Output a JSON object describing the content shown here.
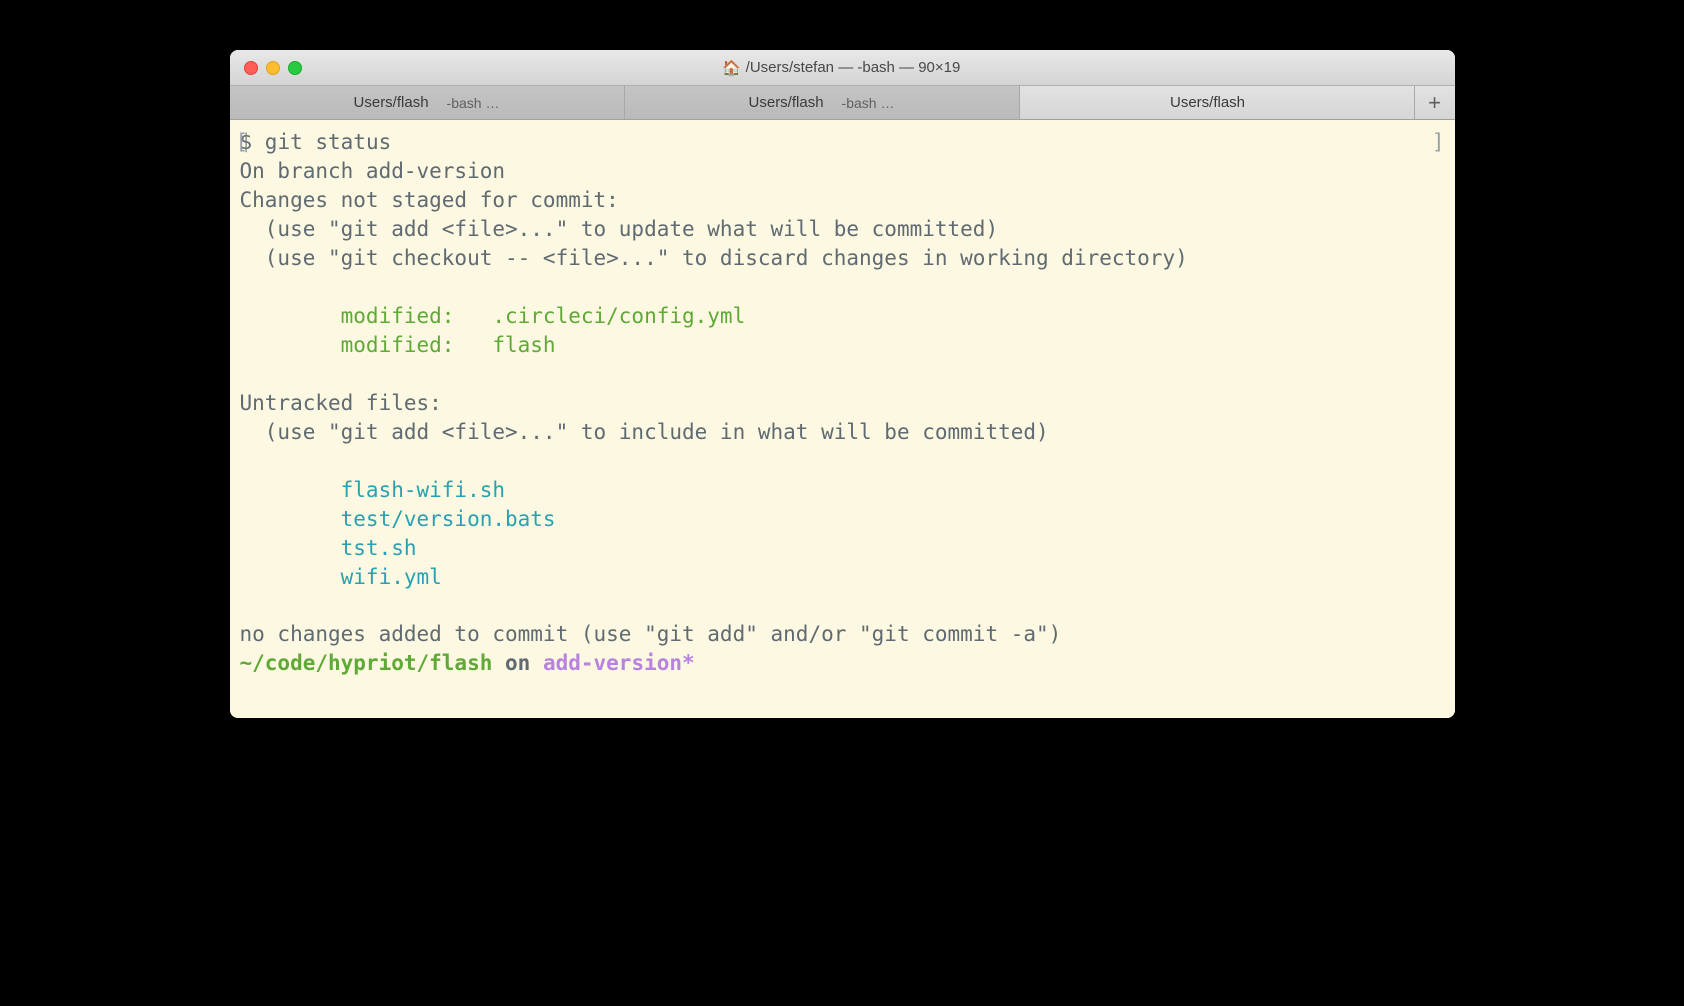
{
  "window": {
    "title": "/Users/stefan — -bash — 90×19",
    "home_icon": "🏠"
  },
  "tabs": [
    {
      "title": "Users/flash",
      "sub": "-bash …",
      "active": false
    },
    {
      "title": "Users/flash",
      "sub": "-bash …",
      "active": false
    },
    {
      "title": "Users/flash",
      "sub": "",
      "active": true
    }
  ],
  "terminal": {
    "bracket_left": "[",
    "bracket_right": "]",
    "prompt": "$ ",
    "command": "git status",
    "lines": {
      "branch": "On branch add-version",
      "not_staged": "Changes not staged for commit:",
      "hint_add": "  (use \"git add <file>...\" to update what will be committed)",
      "hint_checkout": "  (use \"git checkout -- <file>...\" to discard changes in working directory)",
      "modified_1": "        modified:   .circleci/config.yml",
      "modified_2": "        modified:   flash",
      "untracked": "Untracked files:",
      "hint_untracked": "  (use \"git add <file>...\" to include in what will be committed)",
      "ut_1": "        flash-wifi.sh",
      "ut_2": "        test/version.bats",
      "ut_3": "        tst.sh",
      "ut_4": "        wifi.yml",
      "no_changes": "no changes added to commit (use \"git add\" and/or \"git commit -a\")"
    },
    "ps1": {
      "path": "~/code/hypriot/flash",
      "on": " on ",
      "branch": "add-version",
      "dirty": "*"
    }
  }
}
